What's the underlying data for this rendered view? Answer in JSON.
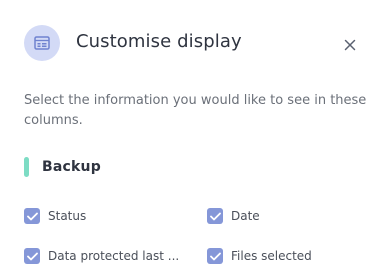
{
  "dialog": {
    "title": "Customise display",
    "header_icon": "display-settings-icon",
    "close_icon": "close-icon",
    "description": "Select the information you would like to see in these columns."
  },
  "section": {
    "label": "Backup",
    "accent_color": "#7ddcc4"
  },
  "options": [
    {
      "label": "Status",
      "checked": true
    },
    {
      "label": "Date",
      "checked": true
    },
    {
      "label": "Data protected last ...",
      "checked": true
    },
    {
      "label": "Files selected",
      "checked": true
    }
  ],
  "colors": {
    "checkbox": "#8597d8",
    "icon_bg": "#d3daf6"
  }
}
